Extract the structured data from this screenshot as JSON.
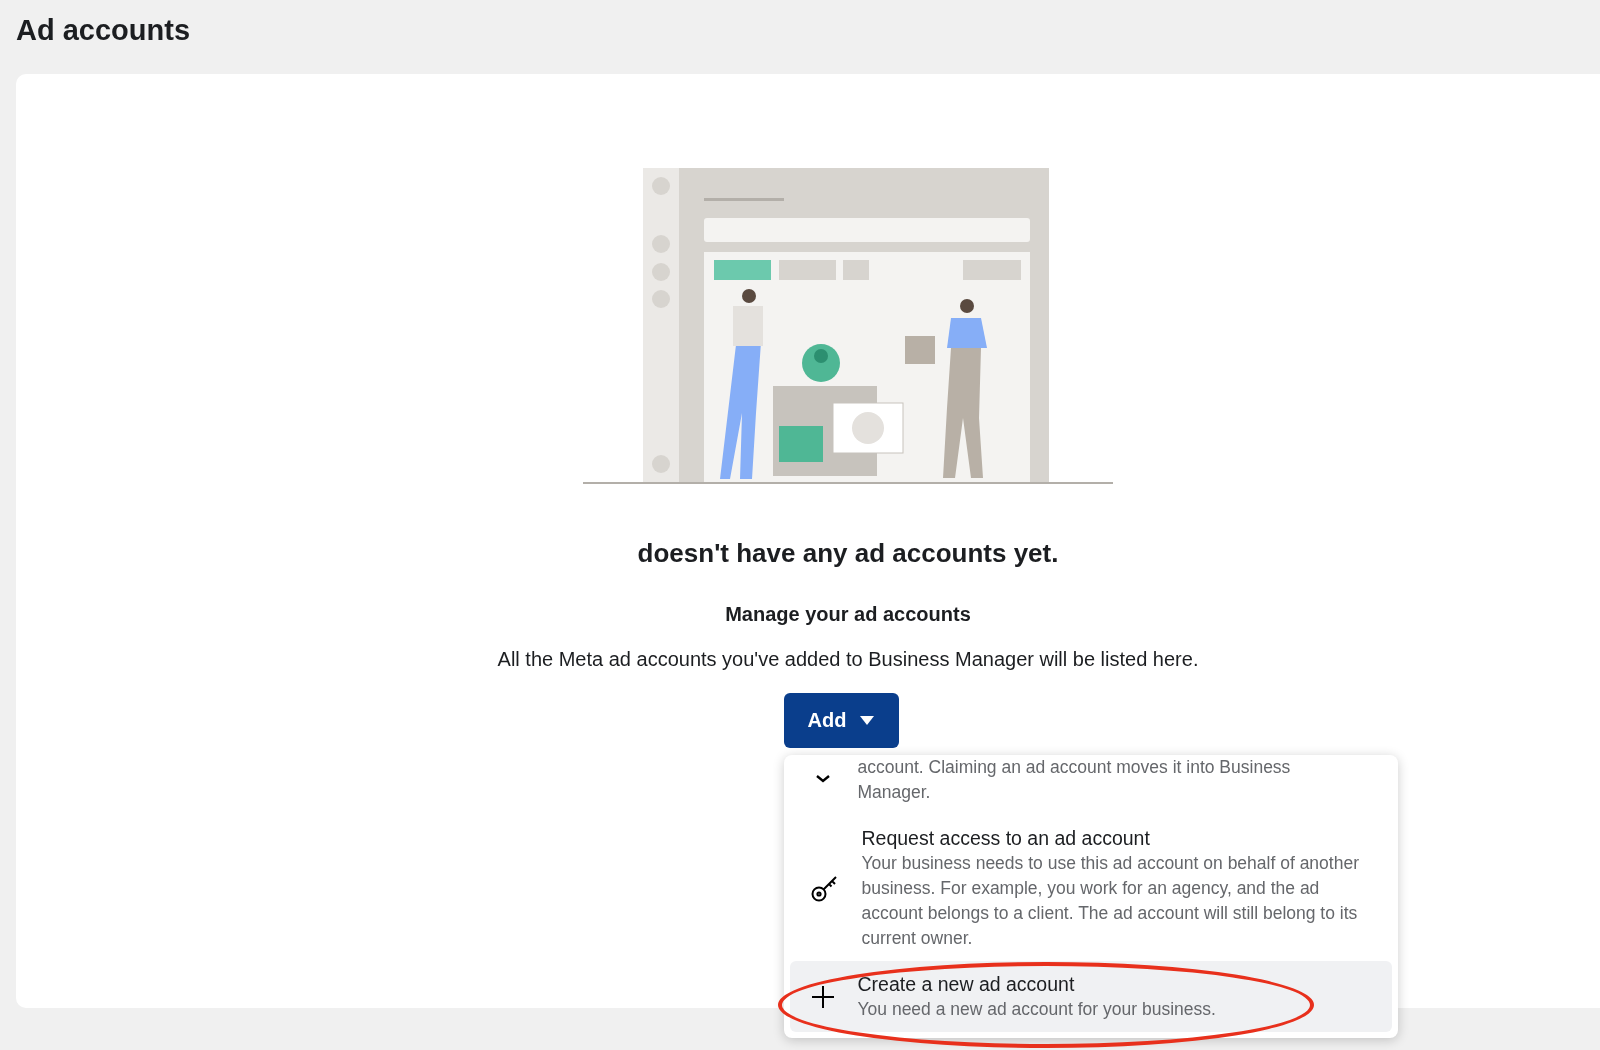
{
  "page": {
    "title": "Ad accounts"
  },
  "empty_state": {
    "headline": "doesn't have any ad accounts yet.",
    "subtitle": "Manage your ad accounts",
    "description": "All the Meta ad accounts you've added to Business Manager will be listed here."
  },
  "add_button": {
    "label": "Add",
    "expanded": true
  },
  "menu": [
    {
      "kind": "claim",
      "description": "account. Claiming an ad account moves it into Business Manager.",
      "selected": false
    },
    {
      "kind": "request",
      "title": "Request access to an ad account",
      "description": "Your business needs to use this ad account on behalf of another business. For example, you work for an agency, and the ad account belongs to a client. The ad account will still belong to its current owner.",
      "selected": false
    },
    {
      "kind": "create",
      "title": "Create a new ad account",
      "description": "You need a new ad account for your business.",
      "selected": true
    }
  ]
}
